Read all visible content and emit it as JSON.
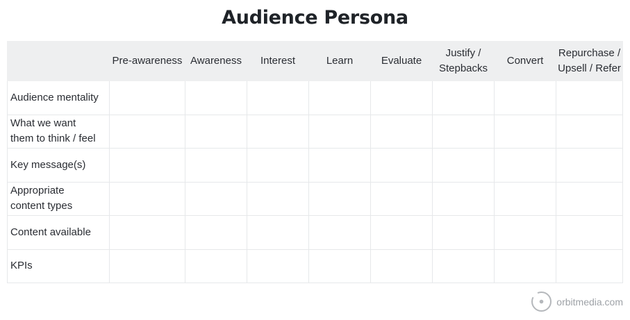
{
  "title": "Audience Persona",
  "columns": [
    "",
    "Pre-awareness",
    "Awareness",
    "Interest",
    "Learn",
    "Evaluate",
    "Justify /\nStepbacks",
    "Convert",
    "Repurchase /\nUpsell / Refer"
  ],
  "rows": [
    {
      "label": "Audience mentality"
    },
    {
      "label": "What we want\nthem to think / feel"
    },
    {
      "label": "Key message(s)"
    },
    {
      "label": "Appropriate\ncontent types"
    },
    {
      "label": "Content available"
    },
    {
      "label": "KPIs"
    }
  ],
  "logo_text": "orbitmedia.com"
}
